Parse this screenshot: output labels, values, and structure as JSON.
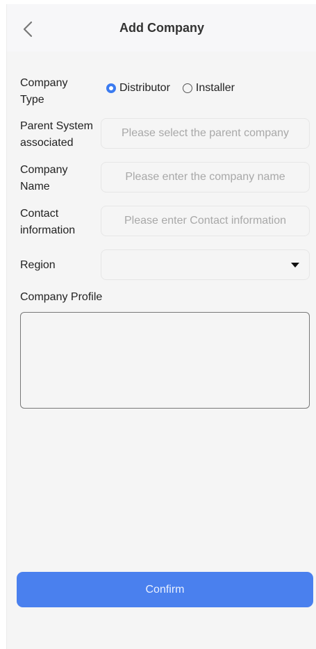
{
  "header": {
    "title": "Add Company",
    "back_icon": "chevron-left-icon"
  },
  "form": {
    "company_type": {
      "label_line1": "Company",
      "label_line2": "Type",
      "options": [
        "Distributor",
        "Installer"
      ],
      "selected": "Distributor"
    },
    "parent_system": {
      "label_line1": "Parent System",
      "label_line2": "associated",
      "placeholder": "Please select the parent company",
      "value": ""
    },
    "company_name": {
      "label_line1": "Company",
      "label_line2": "Name",
      "placeholder": "Please enter the company name",
      "value": ""
    },
    "contact": {
      "label_line1": "Contact",
      "label_line2": "information",
      "placeholder": "Please enter Contact information",
      "value": ""
    },
    "region": {
      "label": "Region",
      "value": "",
      "caret_icon": "caret-down-icon"
    },
    "profile": {
      "label": "Company Profile",
      "value": ""
    }
  },
  "actions": {
    "confirm_label": "Confirm"
  },
  "colors": {
    "accent": "#3b7bf0",
    "confirm_bg": "#4a80ee",
    "background": "#f5f5f5"
  }
}
